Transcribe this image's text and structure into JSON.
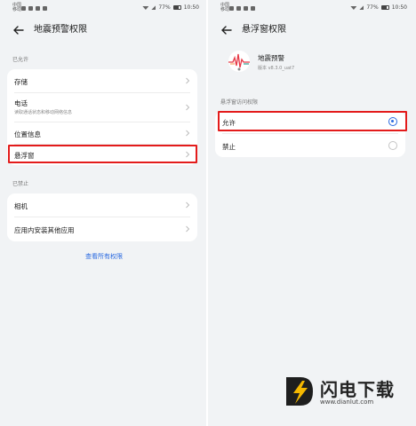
{
  "status_bar": {
    "carrier_text": "中国移动",
    "battery": "77%",
    "time": "10:50"
  },
  "left_screen": {
    "title": "地震预警权限",
    "section_allowed": "已允许",
    "allowed_items": [
      {
        "label": "存储"
      },
      {
        "label": "电话",
        "sub": "读取通话状态和移动网络信息"
      },
      {
        "label": "位置信息"
      },
      {
        "label": "悬浮窗"
      }
    ],
    "section_denied": "已禁止",
    "denied_items": [
      {
        "label": "相机"
      },
      {
        "label": "应用内安装其他应用"
      }
    ],
    "view_all_link": "查看所有权限"
  },
  "right_screen": {
    "title": "悬浮窗权限",
    "app_name": "地震预警",
    "app_version": "版本 v8.3.0_uat7",
    "section_label": "悬浮窗访问权限",
    "options": [
      {
        "label": "允许",
        "selected": true
      },
      {
        "label": "禁止",
        "selected": false
      }
    ]
  },
  "watermark": {
    "text": "闪电下载",
    "url": "www.dianlut.com"
  },
  "colors": {
    "highlight": "#e31b1b",
    "accent": "#2a6ae0",
    "background": "#f1f3f5"
  }
}
